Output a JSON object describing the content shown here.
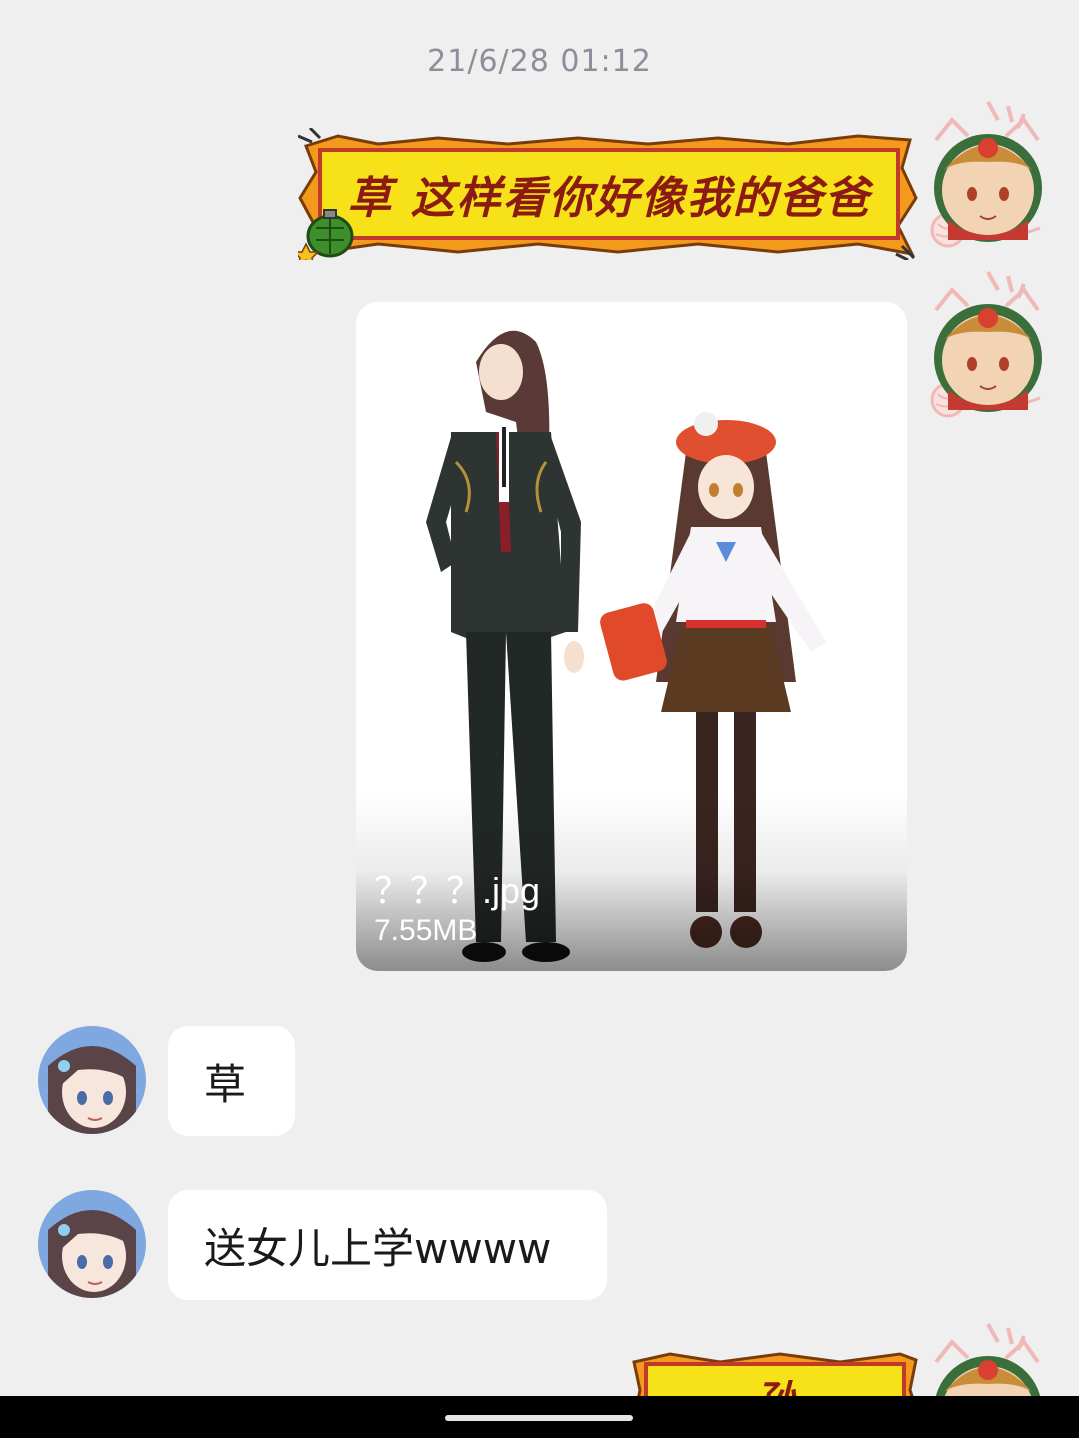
{
  "timestamp": "21/6/28 01:12",
  "messages": {
    "sticker_text_1": "草 这样看你好像我的爸爸",
    "file": {
      "name": "？？？.jpg",
      "size": "7.55MB"
    },
    "reply_1": "草",
    "reply_2": "送女儿上学wwww",
    "sticker_text_2_partial": "孙"
  },
  "colors": {
    "background": "#efefef",
    "sticker_yellow": "#f7e21a",
    "sticker_text": "#8a1a12",
    "timestamp_text": "#8c8f99"
  }
}
